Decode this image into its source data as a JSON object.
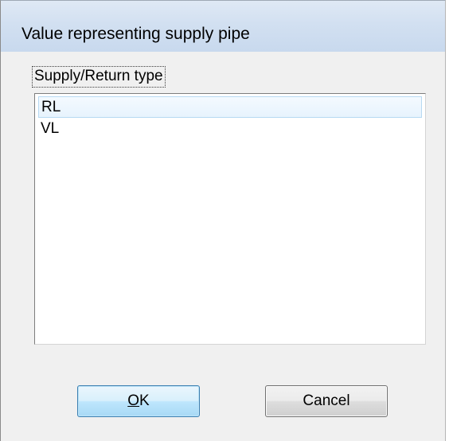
{
  "window": {
    "title": "Value representing supply pipe"
  },
  "group": {
    "label": "Supply/Return type"
  },
  "list": {
    "items": [
      {
        "label": "RL",
        "selected": true
      },
      {
        "label": "VL",
        "selected": false
      }
    ]
  },
  "buttons": {
    "ok_accel": "O",
    "ok_rest": "K",
    "cancel_label": "Cancel"
  },
  "colors": {
    "dialog_background": "#f0f0f0",
    "titlebar": "#d2e0f1",
    "selection_highlight": "#e7f3fd",
    "ok_button_accent": "#3c7fb1"
  }
}
